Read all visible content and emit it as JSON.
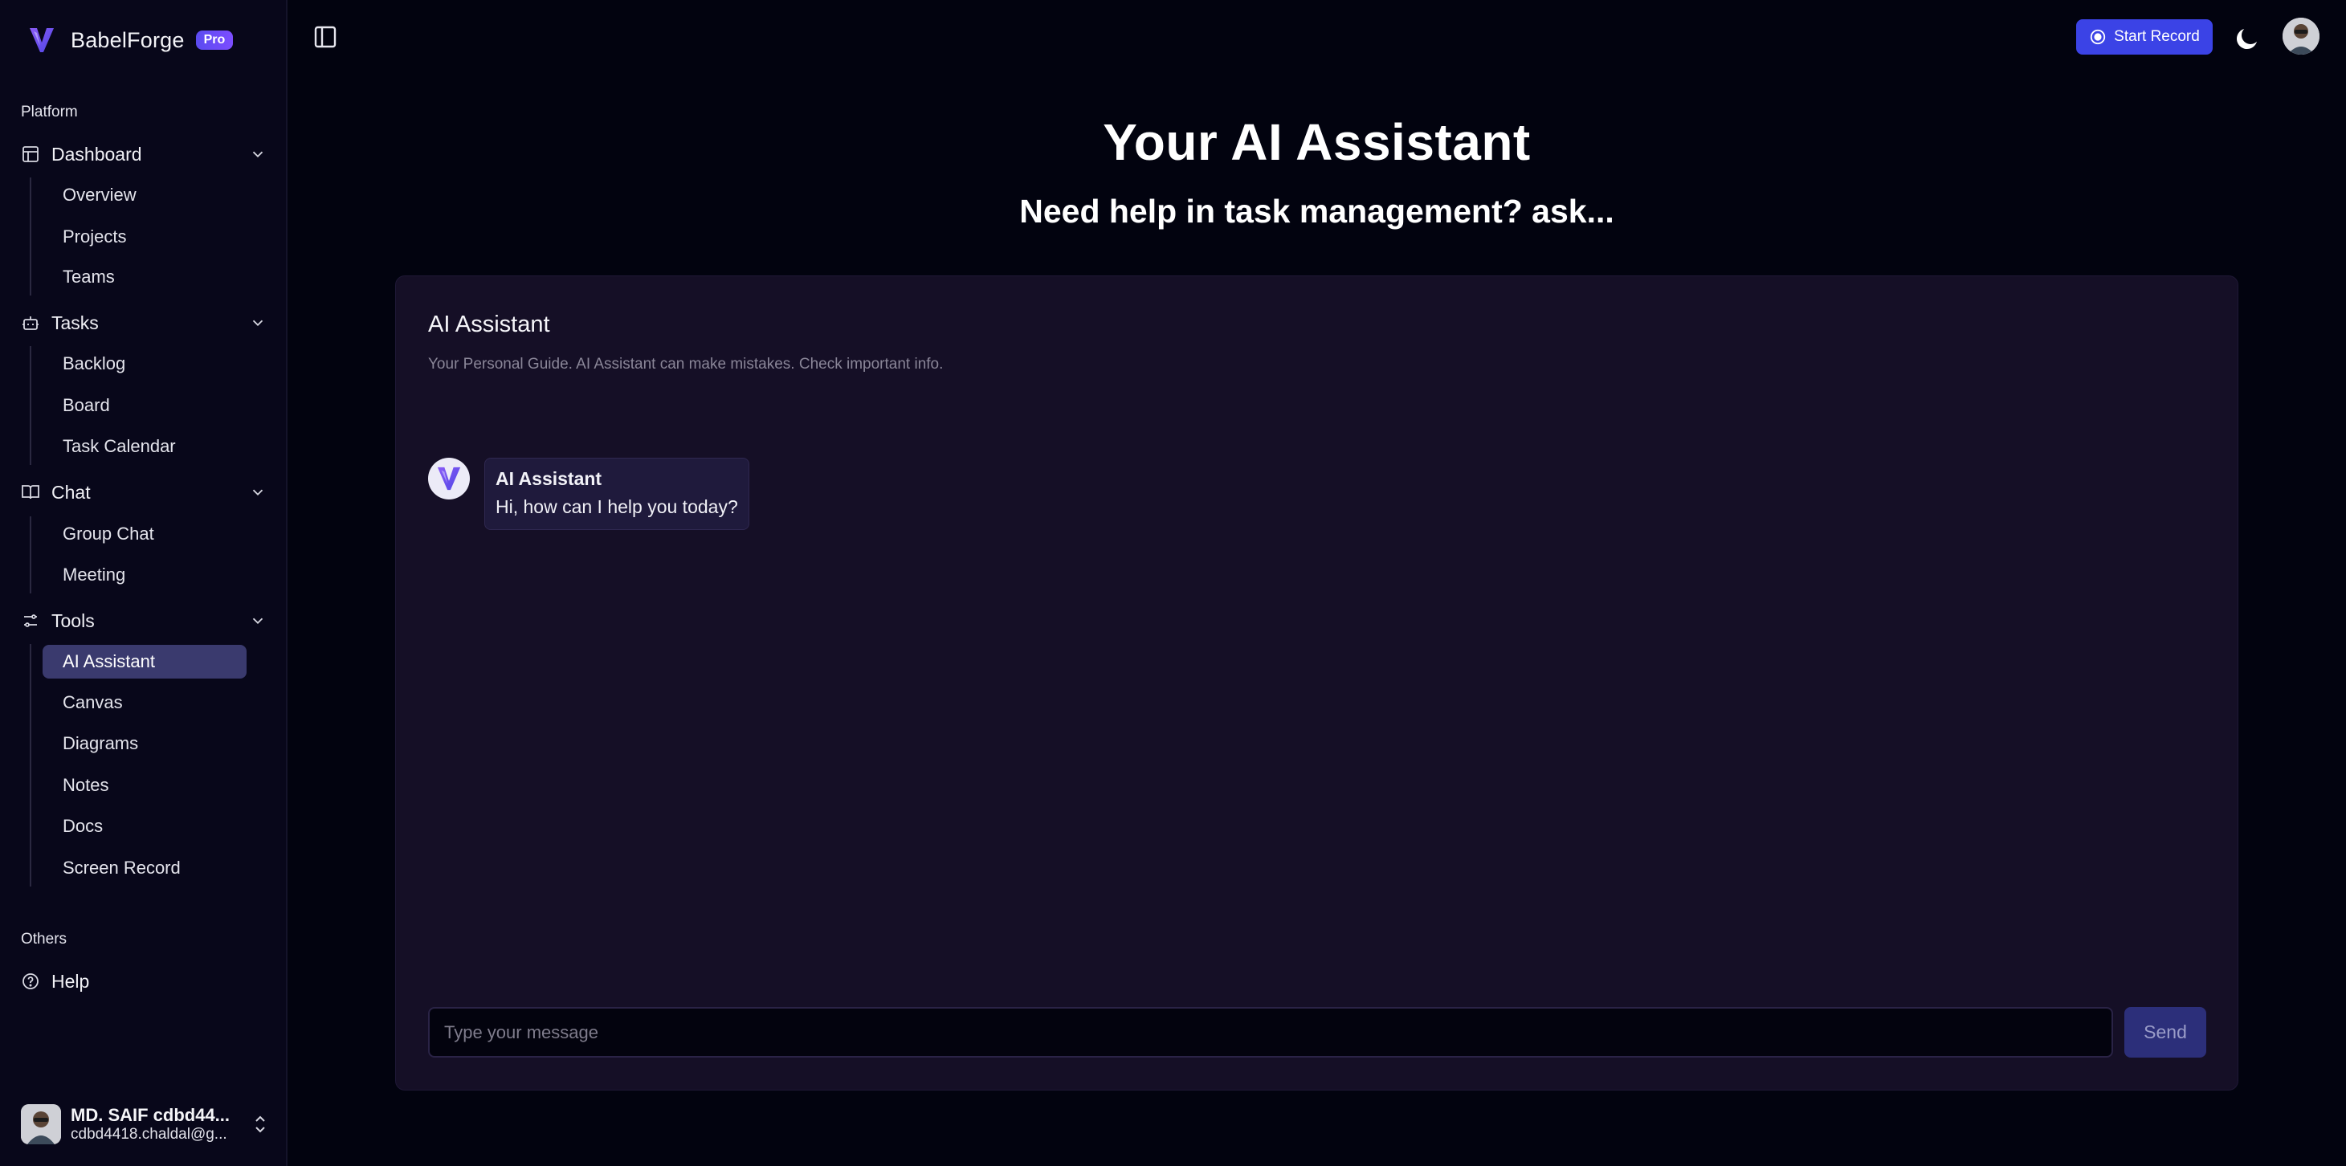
{
  "brand": {
    "name": "BabelForge",
    "badge": "Pro"
  },
  "sidebar": {
    "section_platform": "Platform",
    "section_others": "Others",
    "groups": [
      {
        "label": "Dashboard",
        "icon": "dashboard-icon",
        "items": [
          "Overview",
          "Projects",
          "Teams"
        ]
      },
      {
        "label": "Tasks",
        "icon": "bot-icon",
        "items": [
          "Backlog",
          "Board",
          "Task Calendar"
        ]
      },
      {
        "label": "Chat",
        "icon": "book-icon",
        "items": [
          "Group Chat",
          "Meeting"
        ]
      },
      {
        "label": "Tools",
        "icon": "tools-icon",
        "items": [
          "AI Assistant",
          "Canvas",
          "Diagrams",
          "Notes",
          "Docs",
          "Screen Record"
        ]
      }
    ],
    "active_item": "AI Assistant",
    "help": "Help",
    "user": {
      "name": "MD. SAIF cdbd44...",
      "email": "cdbd4418.chaldal@g..."
    }
  },
  "topbar": {
    "record_label": "Start Record"
  },
  "hero": {
    "title": "Your AI Assistant",
    "subtitle": "Need help in task management? ask..."
  },
  "chat": {
    "title": "AI Assistant",
    "description": "Your Personal Guide. AI Assistant can make mistakes. Check important info.",
    "messages": [
      {
        "sender": "AI Assistant",
        "text": "Hi, how can I help you today?"
      }
    ],
    "input_placeholder": "Type your message",
    "send_label": "Send"
  },
  "colors": {
    "background": "#02030f",
    "sidebar": "#08071a",
    "card": "#150f26",
    "accent": "#3b43e6",
    "active_item": "#3a3a6e"
  }
}
